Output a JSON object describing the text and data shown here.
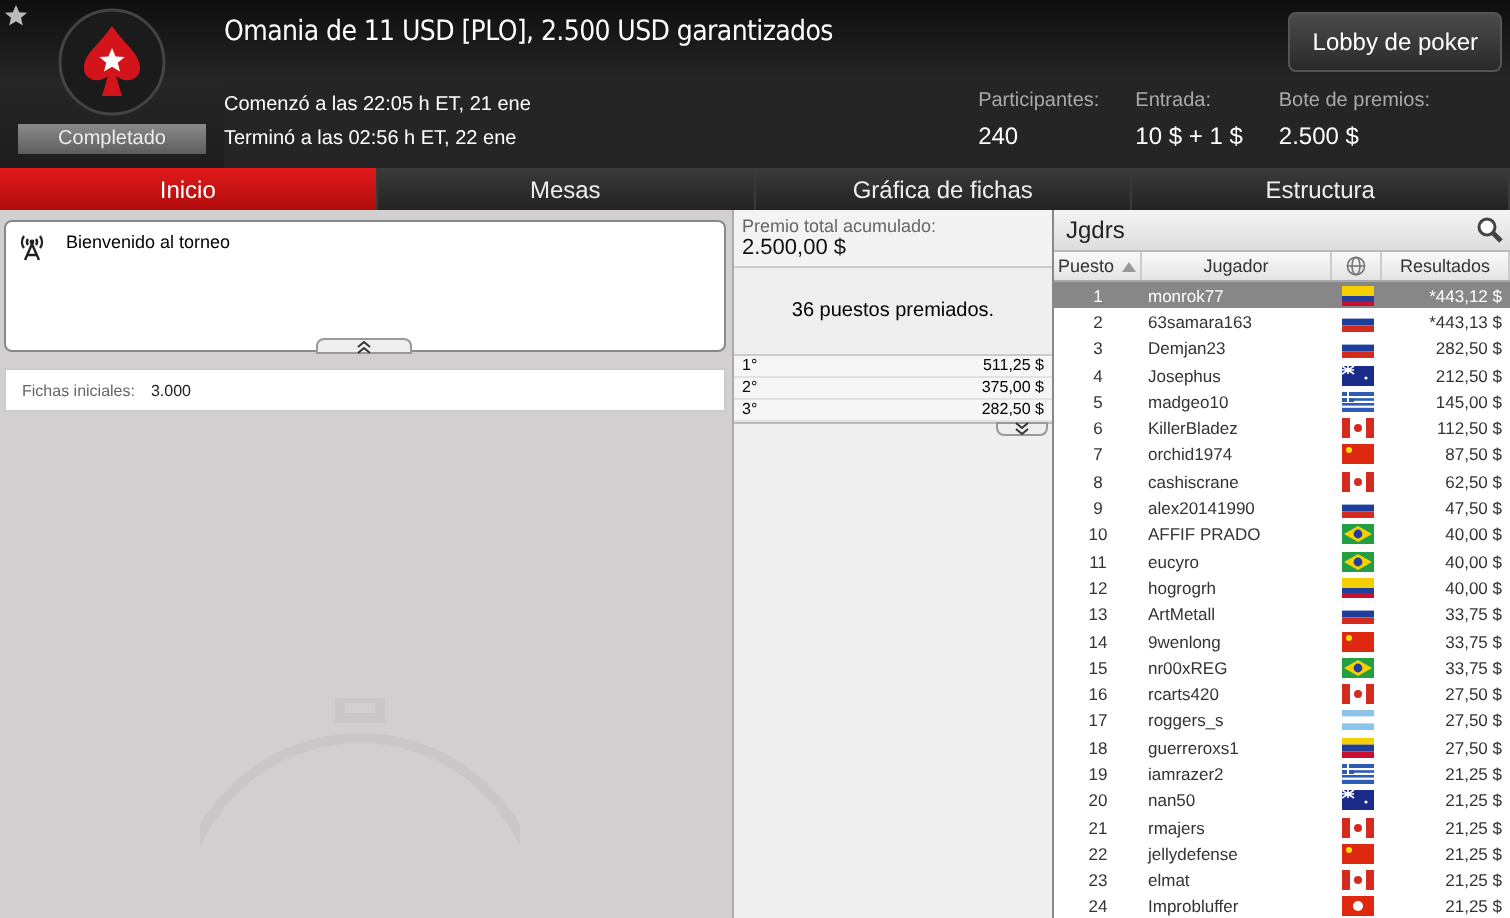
{
  "header": {
    "title": "Omania de 11 USD [PLO], 2.500 USD garantizados",
    "status": "Completado",
    "lobby_button": "Lobby de poker",
    "started": "Comenzó a las 22:05 h ET, 21 ene",
    "ended": "Terminó a las 02:56 h ET, 22 ene",
    "stats": [
      {
        "label": "Participantes:",
        "value": "240"
      },
      {
        "label": "Entrada:",
        "value": "10 $ + 1 $"
      },
      {
        "label": "Bote de premios:",
        "value": "2.500 $"
      }
    ]
  },
  "tabs": [
    {
      "label": "Inicio",
      "selected": true
    },
    {
      "label": "Mesas",
      "selected": false
    },
    {
      "label": "Gráfica de fichas",
      "selected": false
    },
    {
      "label": "Estructura",
      "selected": false
    }
  ],
  "news": {
    "message": "Bienvenido al torneo"
  },
  "starting_chips": {
    "label": "Fichas iniciales:",
    "value": "3.000"
  },
  "prizes": {
    "label": "Premio total acumulado:",
    "total": "2.500,00 $",
    "places_paid": "36 puestos premiados.",
    "rows": [
      {
        "place": "1°",
        "amount": "511,25 $"
      },
      {
        "place": "2°",
        "amount": "375,00 $"
      },
      {
        "place": "3°",
        "amount": "282,50 $"
      }
    ]
  },
  "players": {
    "title": "Jgdrs",
    "columns": [
      "Puesto",
      "Jugador",
      "Resultados"
    ],
    "rows": [
      {
        "rank": "1",
        "name": "monrok77",
        "kind": "co",
        "result": "*443,12 $",
        "selected": true
      },
      {
        "rank": "2",
        "name": "63samara163",
        "kind": "ru",
        "result": "*443,13 $",
        "selected": false
      },
      {
        "rank": "3",
        "name": "Demjan23",
        "kind": "ru",
        "result": "282,50 $",
        "selected": false
      },
      {
        "rank": "4",
        "name": "Josephus",
        "kind": "au",
        "result": "212,50 $",
        "selected": false
      },
      {
        "rank": "5",
        "name": "madgeo10",
        "kind": "gr",
        "result": "145,00 $",
        "selected": false
      },
      {
        "rank": "6",
        "name": "KillerBladez",
        "kind": "ca",
        "result": "112,50 $",
        "selected": false
      },
      {
        "rank": "7",
        "name": "orchid1974",
        "kind": "cn",
        "result": "87,50 $",
        "selected": false
      },
      {
        "rank": "8",
        "name": "cashiscrane",
        "kind": "ca",
        "result": "62,50 $",
        "selected": false
      },
      {
        "rank": "9",
        "name": "alex20141990",
        "kind": "ru",
        "result": "47,50 $",
        "selected": false
      },
      {
        "rank": "10",
        "name": "AFFIF PRADO",
        "kind": "br",
        "result": "40,00 $",
        "selected": false
      },
      {
        "rank": "11",
        "name": "eucyro",
        "kind": "br",
        "result": "40,00 $",
        "selected": false
      },
      {
        "rank": "12",
        "name": "hogrogrh",
        "kind": "co",
        "result": "40,00 $",
        "selected": false
      },
      {
        "rank": "13",
        "name": "ArtMetall",
        "kind": "ru",
        "result": "33,75 $",
        "selected": false
      },
      {
        "rank": "14",
        "name": "9wenlong",
        "kind": "cn",
        "result": "33,75 $",
        "selected": false
      },
      {
        "rank": "15",
        "name": "nr00xREG",
        "kind": "br",
        "result": "33,75 $",
        "selected": false
      },
      {
        "rank": "16",
        "name": "rcarts420",
        "kind": "ca",
        "result": "27,50 $",
        "selected": false
      },
      {
        "rank": "17",
        "name": "roggers_s",
        "kind": "ar",
        "result": "27,50 $",
        "selected": false
      },
      {
        "rank": "18",
        "name": "guerreroxs1",
        "kind": "ve",
        "result": "27,50 $",
        "selected": false
      },
      {
        "rank": "19",
        "name": "iamrazer2",
        "kind": "gr",
        "result": "21,25 $",
        "selected": false
      },
      {
        "rank": "20",
        "name": "nan50",
        "kind": "au",
        "result": "21,25 $",
        "selected": false
      },
      {
        "rank": "21",
        "name": "rmajers",
        "kind": "ca",
        "result": "21,25 $",
        "selected": false
      },
      {
        "rank": "22",
        "name": "jellydefense",
        "kind": "cn",
        "result": "21,25 $",
        "selected": false
      },
      {
        "rank": "23",
        "name": "elmat",
        "kind": "ca",
        "result": "21,25 $",
        "selected": false
      },
      {
        "rank": "24",
        "name": "Improbluffer",
        "kind": "hk",
        "result": "21,25 $",
        "selected": false
      }
    ]
  }
}
